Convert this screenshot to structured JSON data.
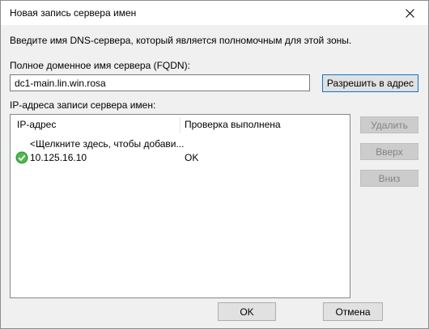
{
  "window": {
    "title": "Новая запись сервера имен"
  },
  "main": {
    "instruction": "Введите имя DNS-сервера, который является полномочным для этой зоны.",
    "fqdn_label": "Полное доменное имя сервера (FQDN):",
    "fqdn_value": "dc1-main.lin.win.rosa",
    "resolve_button": "Разрешить в адрес",
    "ip_list_label": "IP-адреса записи сервера имен:"
  },
  "list": {
    "columns": [
      "IP-адрес",
      "Проверка выполнена"
    ],
    "rows": [
      {
        "ip": "<Щелкните здесь, чтобы добави...",
        "status": "",
        "icon": ""
      },
      {
        "ip": "10.125.16.10",
        "status": "OK",
        "icon": "check-ok-icon"
      }
    ]
  },
  "side_buttons": {
    "delete": "Удалить",
    "up": "Вверх",
    "down": "Вниз"
  },
  "footer": {
    "ok": "OK",
    "cancel": "Отмена"
  },
  "colors": {
    "accent": "#0078d7",
    "ok_green": "#2f9e2f"
  }
}
